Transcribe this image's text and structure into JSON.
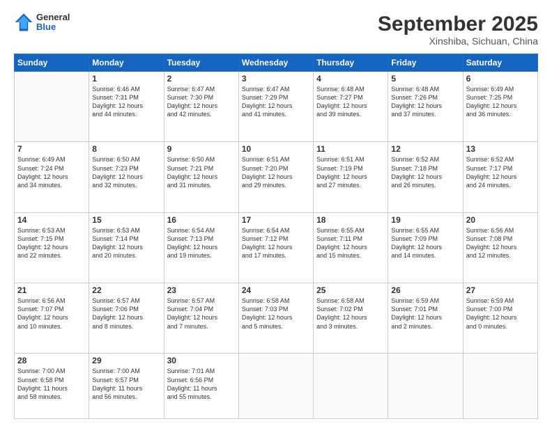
{
  "header": {
    "logo": {
      "general": "General",
      "blue": "Blue"
    },
    "title": "September 2025",
    "location": "Xinshiba, Sichuan, China"
  },
  "days_of_week": [
    "Sunday",
    "Monday",
    "Tuesday",
    "Wednesday",
    "Thursday",
    "Friday",
    "Saturday"
  ],
  "weeks": [
    [
      {
        "day": "",
        "content": ""
      },
      {
        "day": "1",
        "content": "Sunrise: 6:46 AM\nSunset: 7:31 PM\nDaylight: 12 hours\nand 44 minutes."
      },
      {
        "day": "2",
        "content": "Sunrise: 6:47 AM\nSunset: 7:30 PM\nDaylight: 12 hours\nand 42 minutes."
      },
      {
        "day": "3",
        "content": "Sunrise: 6:47 AM\nSunset: 7:29 PM\nDaylight: 12 hours\nand 41 minutes."
      },
      {
        "day": "4",
        "content": "Sunrise: 6:48 AM\nSunset: 7:27 PM\nDaylight: 12 hours\nand 39 minutes."
      },
      {
        "day": "5",
        "content": "Sunrise: 6:48 AM\nSunset: 7:26 PM\nDaylight: 12 hours\nand 37 minutes."
      },
      {
        "day": "6",
        "content": "Sunrise: 6:49 AM\nSunset: 7:25 PM\nDaylight: 12 hours\nand 36 minutes."
      }
    ],
    [
      {
        "day": "7",
        "content": "Sunrise: 6:49 AM\nSunset: 7:24 PM\nDaylight: 12 hours\nand 34 minutes."
      },
      {
        "day": "8",
        "content": "Sunrise: 6:50 AM\nSunset: 7:23 PM\nDaylight: 12 hours\nand 32 minutes."
      },
      {
        "day": "9",
        "content": "Sunrise: 6:50 AM\nSunset: 7:21 PM\nDaylight: 12 hours\nand 31 minutes."
      },
      {
        "day": "10",
        "content": "Sunrise: 6:51 AM\nSunset: 7:20 PM\nDaylight: 12 hours\nand 29 minutes."
      },
      {
        "day": "11",
        "content": "Sunrise: 6:51 AM\nSunset: 7:19 PM\nDaylight: 12 hours\nand 27 minutes."
      },
      {
        "day": "12",
        "content": "Sunrise: 6:52 AM\nSunset: 7:18 PM\nDaylight: 12 hours\nand 26 minutes."
      },
      {
        "day": "13",
        "content": "Sunrise: 6:52 AM\nSunset: 7:17 PM\nDaylight: 12 hours\nand 24 minutes."
      }
    ],
    [
      {
        "day": "14",
        "content": "Sunrise: 6:53 AM\nSunset: 7:15 PM\nDaylight: 12 hours\nand 22 minutes."
      },
      {
        "day": "15",
        "content": "Sunrise: 6:53 AM\nSunset: 7:14 PM\nDaylight: 12 hours\nand 20 minutes."
      },
      {
        "day": "16",
        "content": "Sunrise: 6:54 AM\nSunset: 7:13 PM\nDaylight: 12 hours\nand 19 minutes."
      },
      {
        "day": "17",
        "content": "Sunrise: 6:54 AM\nSunset: 7:12 PM\nDaylight: 12 hours\nand 17 minutes."
      },
      {
        "day": "18",
        "content": "Sunrise: 6:55 AM\nSunset: 7:11 PM\nDaylight: 12 hours\nand 15 minutes."
      },
      {
        "day": "19",
        "content": "Sunrise: 6:55 AM\nSunset: 7:09 PM\nDaylight: 12 hours\nand 14 minutes."
      },
      {
        "day": "20",
        "content": "Sunrise: 6:56 AM\nSunset: 7:08 PM\nDaylight: 12 hours\nand 12 minutes."
      }
    ],
    [
      {
        "day": "21",
        "content": "Sunrise: 6:56 AM\nSunset: 7:07 PM\nDaylight: 12 hours\nand 10 minutes."
      },
      {
        "day": "22",
        "content": "Sunrise: 6:57 AM\nSunset: 7:06 PM\nDaylight: 12 hours\nand 8 minutes."
      },
      {
        "day": "23",
        "content": "Sunrise: 6:57 AM\nSunset: 7:04 PM\nDaylight: 12 hours\nand 7 minutes."
      },
      {
        "day": "24",
        "content": "Sunrise: 6:58 AM\nSunset: 7:03 PM\nDaylight: 12 hours\nand 5 minutes."
      },
      {
        "day": "25",
        "content": "Sunrise: 6:58 AM\nSunset: 7:02 PM\nDaylight: 12 hours\nand 3 minutes."
      },
      {
        "day": "26",
        "content": "Sunrise: 6:59 AM\nSunset: 7:01 PM\nDaylight: 12 hours\nand 2 minutes."
      },
      {
        "day": "27",
        "content": "Sunrise: 6:59 AM\nSunset: 7:00 PM\nDaylight: 12 hours\nand 0 minutes."
      }
    ],
    [
      {
        "day": "28",
        "content": "Sunrise: 7:00 AM\nSunset: 6:58 PM\nDaylight: 11 hours\nand 58 minutes."
      },
      {
        "day": "29",
        "content": "Sunrise: 7:00 AM\nSunset: 6:57 PM\nDaylight: 11 hours\nand 56 minutes."
      },
      {
        "day": "30",
        "content": "Sunrise: 7:01 AM\nSunset: 6:56 PM\nDaylight: 11 hours\nand 55 minutes."
      },
      {
        "day": "",
        "content": ""
      },
      {
        "day": "",
        "content": ""
      },
      {
        "day": "",
        "content": ""
      },
      {
        "day": "",
        "content": ""
      }
    ]
  ]
}
